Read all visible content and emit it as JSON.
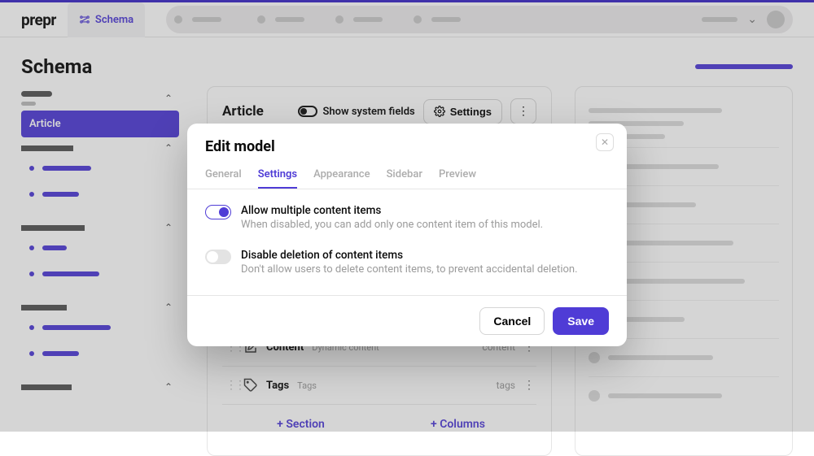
{
  "topbar": {
    "logo": "prepr",
    "tab_label": "Schema"
  },
  "page": {
    "title": "Schema"
  },
  "sidebar": {
    "active_item": "Article"
  },
  "content": {
    "model_name": "Article",
    "show_system_fields_label": "Show system fields",
    "settings_btn": "Settings",
    "fields": [
      {
        "name": "Content",
        "type": "Dynamic content",
        "id": "content"
      },
      {
        "name": "Tags",
        "type": "Tags",
        "id": "tags"
      }
    ],
    "add_section": "Section",
    "add_columns": "Columns"
  },
  "modal": {
    "title": "Edit model",
    "tabs": [
      "General",
      "Settings",
      "Appearance",
      "Sidebar",
      "Preview"
    ],
    "active_tab": "Settings",
    "settings": [
      {
        "label": "Allow multiple content items",
        "desc": "When disabled, you can add only one content item of this model.",
        "on": true
      },
      {
        "label": "Disable deletion of content items",
        "desc": "Don't allow users to delete content items, to prevent accidental deletion.",
        "on": false
      }
    ],
    "cancel": "Cancel",
    "save": "Save"
  }
}
